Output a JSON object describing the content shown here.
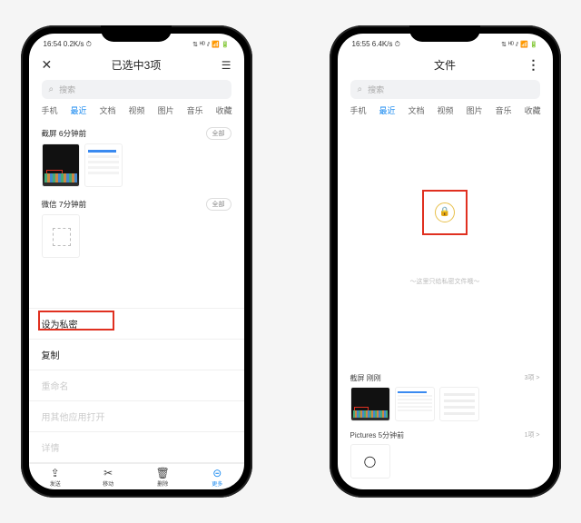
{
  "phone1": {
    "status": {
      "time": "16:54",
      "net": "0.2K/s ⏱",
      "right": "⇅ ᴴᴰ ⫽ 📶 🔋"
    },
    "header": {
      "title": "已选中3项"
    },
    "search": {
      "placeholder": "搜索"
    },
    "tabs": [
      "手机",
      "最近",
      "文档",
      "视频",
      "图片",
      "音乐",
      "收藏"
    ],
    "tabs_active": 1,
    "section1": {
      "title": "截屏  6分钟前",
      "badge": "全部"
    },
    "section2": {
      "title": "微信  7分钟前",
      "badge": "全部"
    },
    "menu": {
      "set_private": "设为私密",
      "copy": "复制",
      "rename": "重命名",
      "open_with": "用其他应用打开",
      "details": "详情"
    },
    "bottom": {
      "send": "发送",
      "move": "移动",
      "delete": "删除",
      "more": "更多"
    }
  },
  "phone2": {
    "status": {
      "time": "16:55",
      "net": "6.4K/s ⏱",
      "right": "⇅ ᴴᴰ ⫽ 📶 🔋"
    },
    "header": {
      "title": "文件"
    },
    "search": {
      "placeholder": "搜索"
    },
    "tabs": [
      "手机",
      "最近",
      "文档",
      "视频",
      "图片",
      "音乐",
      "收藏"
    ],
    "tabs_active": 1,
    "note": "～这里只给私密文件哦～",
    "group1": {
      "title": "截屏  刚刚",
      "meta": "3项 >"
    },
    "group2": {
      "title": "Pictures  5分钟前",
      "meta": "1项 >"
    }
  }
}
